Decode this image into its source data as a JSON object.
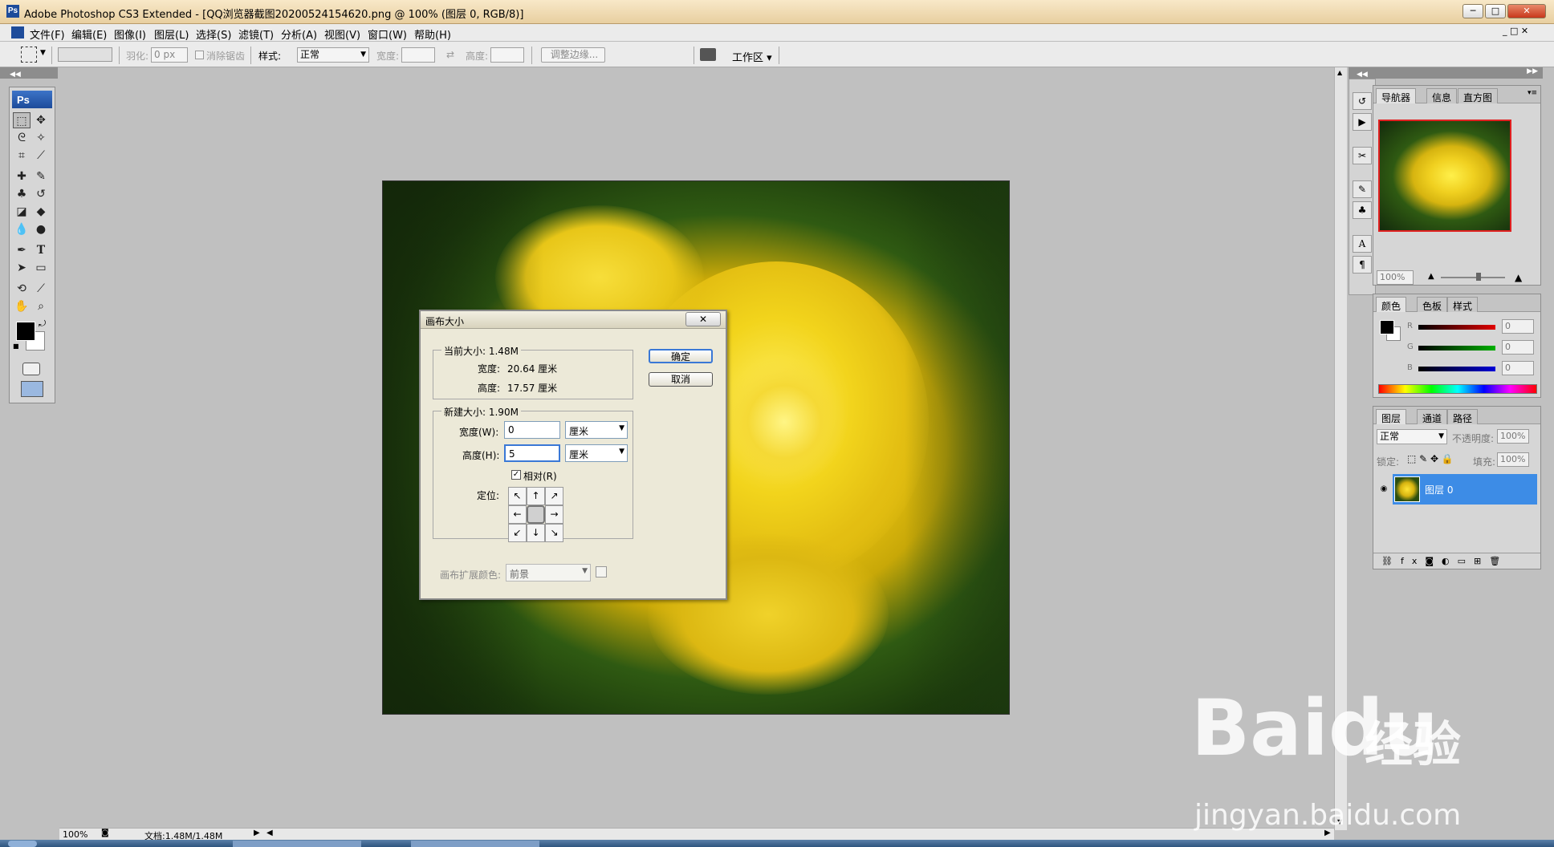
{
  "window": {
    "app_icon": "Ps",
    "title": "Adobe Photoshop CS3 Extended - [QQ浏览器截图20200524154620.png @ 100% (图层 0, RGB/8)]"
  },
  "menu": [
    "文件(F)",
    "编辑(E)",
    "图像(I)",
    "图层(L)",
    "选择(S)",
    "滤镜(T)",
    "分析(A)",
    "视图(V)",
    "窗口(W)",
    "帮助(H)"
  ],
  "options": {
    "feather_label": "羽化:",
    "feather_value": "0 px",
    "antialias_label": "消除锯齿",
    "style_label": "样式:",
    "style_value": "正常",
    "width_label": "宽度:",
    "height_label": "高度:",
    "refine_edge": "调整边缘...",
    "workspace": "工作区 ▾"
  },
  "toolbox": {
    "logo": "Ps"
  },
  "dialog": {
    "title": "画布大小",
    "close": "✕",
    "current_group": "当前大小: 1.48M",
    "current_width_label": "宽度:",
    "current_width_value": "20.64 厘米",
    "current_height_label": "高度:",
    "current_height_value": "17.57 厘米",
    "new_group": "新建大小: 1.90M",
    "width_label": "宽度(W):",
    "width_value": "0",
    "height_label": "高度(H):",
    "height_value": "5",
    "unit": "厘米",
    "relative_label": "相对(R)",
    "relative_checked": true,
    "anchor_label": "定位:",
    "anchor_arrows": [
      "↖",
      "↑",
      "↗",
      "←",
      "",
      "→",
      "↙",
      "↓",
      "↘"
    ],
    "ext_color_label": "画布扩展颜色:",
    "ext_color_value": "前景",
    "ok": "确定",
    "cancel": "取消"
  },
  "navigator": {
    "tabs": [
      "导航器",
      "信息",
      "直方图"
    ],
    "zoom": "100%"
  },
  "color_panel": {
    "tabs": [
      "颜色",
      "色板",
      "样式"
    ],
    "channels": [
      {
        "label": "R",
        "value": "0",
        "color": "#e00000"
      },
      {
        "label": "G",
        "value": "0",
        "color": "#00b000"
      },
      {
        "label": "B",
        "value": "0",
        "color": "#0000d8"
      }
    ]
  },
  "layers_panel": {
    "tabs": [
      "图层",
      "通道",
      "路径"
    ],
    "blend_mode": "正常",
    "opacity_label": "不透明度:",
    "opacity_value": "100%",
    "lock_label": "锁定:",
    "fill_label": "填充:",
    "fill_value": "100%",
    "layer_name": "图层 0"
  },
  "status": {
    "zoom": "100%",
    "doc": "文档:1.48M/1.48M"
  },
  "watermark": {
    "brand": "Bai",
    "brand2": "du",
    "cn": "经验",
    "url": "jingyan.baidu.com"
  }
}
